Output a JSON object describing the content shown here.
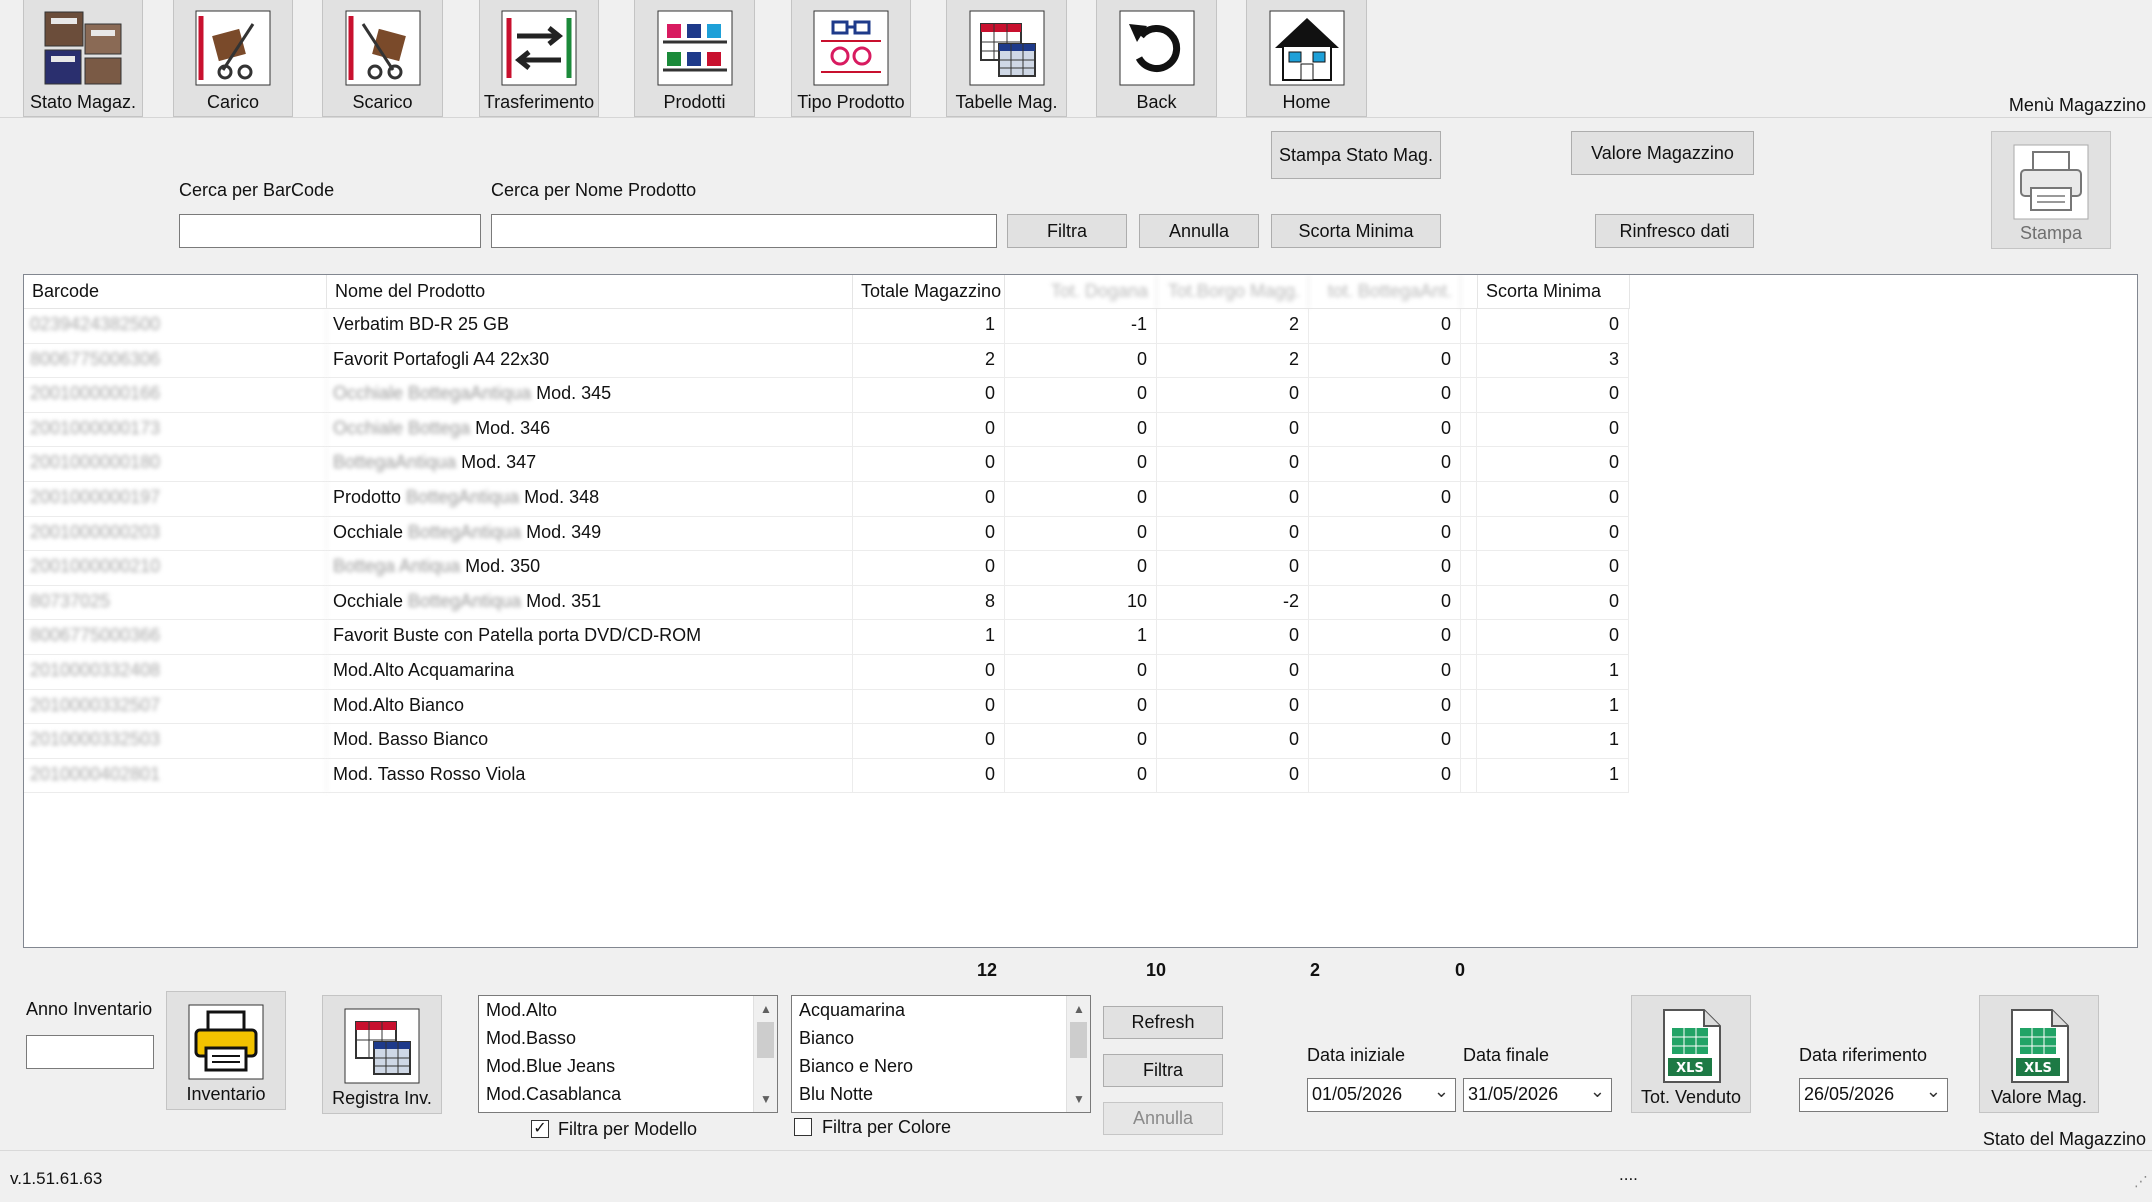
{
  "toolbar": {
    "buttons": [
      {
        "label": "Stato Magaz.",
        "icon": "warehouse-boxes-icon"
      },
      {
        "label": "Carico",
        "icon": "hand-truck-load-icon"
      },
      {
        "label": "Scarico",
        "icon": "hand-truck-unload-icon"
      },
      {
        "label": "Trasferimento",
        "icon": "transfer-arrows-icon"
      },
      {
        "label": "Prodotti",
        "icon": "product-shelves-icon"
      },
      {
        "label": "Tipo Prodotto",
        "icon": "glasses-type-icon"
      },
      {
        "label": "Tabelle Mag.",
        "icon": "tables-icon"
      },
      {
        "label": "Back",
        "icon": "back-arrow-icon"
      },
      {
        "label": "Home",
        "icon": "home-icon"
      }
    ],
    "menu_title": "Menù Magazzino"
  },
  "search": {
    "barcode_label": "Cerca per BarCode",
    "barcode_value": "",
    "name_label": "Cerca per Nome Prodotto",
    "name_value": ""
  },
  "actions": {
    "filtra": "Filtra",
    "annulla": "Annulla",
    "scorta_minima": "Scorta Minima",
    "stampa_stato": "Stampa Stato Mag.",
    "valore_magazzino": "Valore Magazzino",
    "rinfresco": "Rinfresco dati",
    "stampa": "Stampa"
  },
  "grid": {
    "headers": [
      "Barcode",
      "Nome del Prodotto",
      "Totale Magazzino",
      "Tot. Dogana",
      "Tot.Borgo Magg.",
      "tot. BottegaAnt.",
      "Scorta Minima"
    ],
    "rows": [
      {
        "barcode": "0239424382500",
        "name": "Verbatim BD-R 25 GB",
        "name_blur": "",
        "name_suffix": "",
        "tot": "1",
        "dog": "-1",
        "borgo": "2",
        "bott": "0",
        "scorta": "0"
      },
      {
        "barcode": "8006775006306",
        "name": "Favorit Portafogli A4 22x30",
        "name_blur": "",
        "name_suffix": "",
        "tot": "2",
        "dog": "0",
        "borgo": "2",
        "bott": "0",
        "scorta": "3"
      },
      {
        "barcode": "2001000000166",
        "name": "",
        "name_blur": "Occhiale BottegaAntiqua",
        "name_suffix": " Mod. 345",
        "tot": "0",
        "dog": "0",
        "borgo": "0",
        "bott": "0",
        "scorta": "0"
      },
      {
        "barcode": "2001000000173",
        "name": "",
        "name_blur": "Occhiale Bottega",
        "name_suffix": " Mod. 346",
        "tot": "0",
        "dog": "0",
        "borgo": "0",
        "bott": "0",
        "scorta": "0"
      },
      {
        "barcode": "2001000000180",
        "name": "",
        "name_blur": "BottegaAntiqua",
        "name_suffix": " Mod. 347",
        "tot": "0",
        "dog": "0",
        "borgo": "0",
        "bott": "0",
        "scorta": "0"
      },
      {
        "barcode": "2001000000197",
        "name": "Prodotto ",
        "name_blur": "BottegAntiqua",
        "name_suffix": " Mod. 348",
        "tot": "0",
        "dog": "0",
        "borgo": "0",
        "bott": "0",
        "scorta": "0"
      },
      {
        "barcode": "2001000000203",
        "name": "Occhiale ",
        "name_blur": "BottegAntiqua",
        "name_suffix": " Mod. 349",
        "tot": "0",
        "dog": "0",
        "borgo": "0",
        "bott": "0",
        "scorta": "0"
      },
      {
        "barcode": "2001000000210",
        "name": "",
        "name_blur": "Bottega Antiqua",
        "name_suffix": " Mod. 350",
        "tot": "0",
        "dog": "0",
        "borgo": "0",
        "bott": "0",
        "scorta": "0"
      },
      {
        "barcode": "80737025",
        "name": "Occhiale ",
        "name_blur": "BottegAntiqua",
        "name_suffix": " Mod. 351",
        "tot": "8",
        "dog": "10",
        "borgo": "-2",
        "bott": "0",
        "scorta": "0"
      },
      {
        "barcode": "8006775000366",
        "name": "Favorit Buste con Patella porta DVD/CD-ROM",
        "name_blur": "",
        "name_suffix": "",
        "tot": "1",
        "dog": "1",
        "borgo": "0",
        "bott": "0",
        "scorta": "0"
      },
      {
        "barcode": "2010000332408",
        "name": "Mod.Alto Acquamarina",
        "name_blur": "",
        "name_suffix": "",
        "tot": "0",
        "dog": "0",
        "borgo": "0",
        "bott": "0",
        "scorta": "1"
      },
      {
        "barcode": "2010000332507",
        "name": "Mod.Alto Bianco",
        "name_blur": "",
        "name_suffix": "",
        "tot": "0",
        "dog": "0",
        "borgo": "0",
        "bott": "0",
        "scorta": "1"
      },
      {
        "barcode": "2010000332503",
        "name": "Mod. Basso Bianco",
        "name_blur": "",
        "name_suffix": "",
        "tot": "0",
        "dog": "0",
        "borgo": "0",
        "bott": "0",
        "scorta": "1"
      },
      {
        "barcode": "2010000402801",
        "name": "Mod. Tasso Rosso Viola",
        "name_blur": "",
        "name_suffix": "",
        "tot": "0",
        "dog": "0",
        "borgo": "0",
        "bott": "0",
        "scorta": "1"
      }
    ],
    "totals": {
      "tot": "12",
      "dog": "10",
      "borgo": "2",
      "bott": "0"
    }
  },
  "bottom": {
    "anno_label": "Anno Inventario",
    "anno_value": "",
    "inventario": "Inventario",
    "registra": "Registra Inv.",
    "models": [
      "Mod.Alto",
      "Mod.Basso",
      "Mod.Blue Jeans",
      "Mod.Casablanca"
    ],
    "filtra_modello": "Filtra per Modello",
    "filtra_modello_checked": true,
    "colors": [
      "Acquamarina",
      "Bianco",
      "Bianco e Nero",
      "Blu Notte"
    ],
    "filtra_colore": "Filtra per Colore",
    "filtra_colore_checked": false,
    "refresh": "Refresh",
    "filtra": "Filtra",
    "annulla": "Annulla",
    "data_iniziale_label": "Data iniziale",
    "data_iniziale": "01/05/2026",
    "data_finale_label": "Data finale",
    "data_finale": "31/05/2026",
    "tot_venduto": "Tot. Venduto",
    "data_rif_label": "Data riferimento",
    "data_rif": "26/05/2026",
    "valore_mag": "Valore Mag.",
    "stato_title": "Stato del Magazzino"
  },
  "status": {
    "version": "v.1.51.61.63",
    "dots": "...."
  }
}
